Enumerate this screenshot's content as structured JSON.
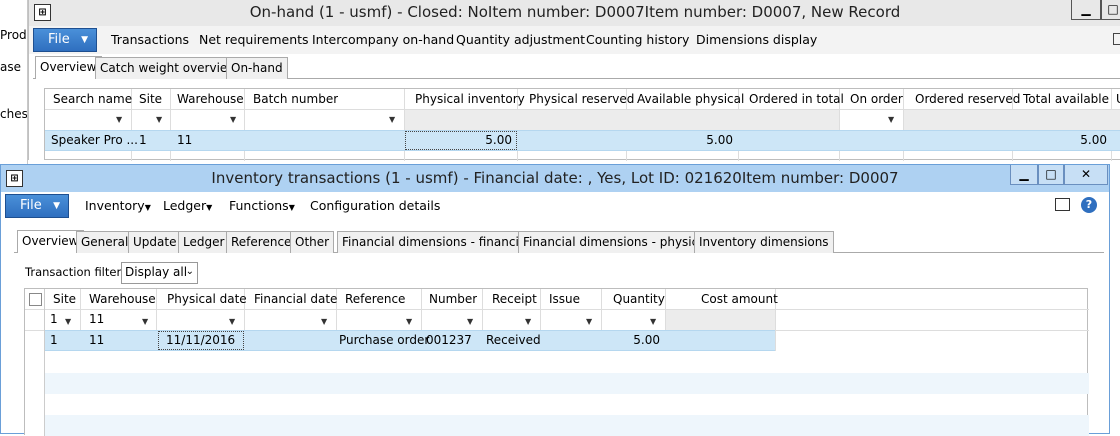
{
  "left_strip": {
    "items": [
      "Prod",
      "ase",
      "ches"
    ]
  },
  "window1": {
    "title": "On-hand (1 - usmf) - Closed: NoItem number: D0007Item number: D0007, New Record",
    "file_label": "File",
    "menu": [
      "Transactions",
      "Net requirements",
      "Intercompany on-hand",
      "Quantity adjustment",
      "Counting history",
      "Dimensions display"
    ],
    "tabs": [
      "Overview",
      "Catch weight overview",
      "On-hand"
    ],
    "columns": [
      "Search name",
      "Site",
      "Warehouse",
      "Batch number",
      "Physical inventory",
      "Physical reserved",
      "Available physical",
      "Ordered in total",
      "On order",
      "Ordered reserved",
      "Total available",
      "U"
    ],
    "row": {
      "search_name": "Speaker Pro ...",
      "site": "1",
      "warehouse": "11",
      "physical_inventory": "5.00",
      "available_physical": "5.00",
      "total_available": "5.00"
    }
  },
  "window2": {
    "title": "Inventory transactions (1 - usmf) - Financial date: , Yes, Lot ID: 021620Item number: D0007",
    "file_label": "File",
    "menu": [
      "Inventory",
      "Ledger",
      "Functions",
      "Configuration details"
    ],
    "tabs": [
      "Overview",
      "General",
      "Update",
      "Ledger",
      "Reference",
      "Other",
      "Financial dimensions - financial",
      "Financial dimensions - physical",
      "Inventory dimensions"
    ],
    "filter_label": "Transaction filter:",
    "filter_value": "Display all",
    "columns": [
      "Site",
      "Warehouse",
      "Physical date",
      "Financial date",
      "Reference",
      "Number",
      "Receipt",
      "Issue",
      "Quantity",
      "Cost amount"
    ],
    "filters": {
      "site": "1",
      "warehouse": "11"
    },
    "row": {
      "site": "1",
      "warehouse": "11",
      "physical_date": "11/11/2016",
      "reference": "Purchase order",
      "number": "001237",
      "receipt": "Received",
      "quantity": "5.00"
    }
  }
}
